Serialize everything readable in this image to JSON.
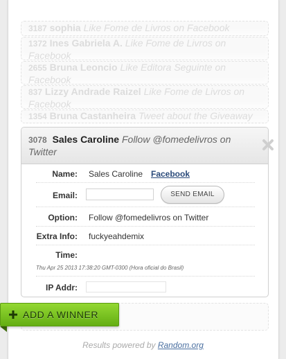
{
  "entries_faded": [
    {
      "number": "3187",
      "name": "sophia",
      "action": "Like Fome de Livros on Facebook"
    },
    {
      "number": "1372",
      "name": "Ines Gabriela A.",
      "action": "Like Fome de Livros on Facebook"
    },
    {
      "number": "2655",
      "name": "Bruna Leoncio",
      "action": "Like Editora Seguinte on Facebook"
    },
    {
      "number": "837",
      "name": "Lizzy Andrade Raizel",
      "action": "Like Fome de Livros on Facebook"
    },
    {
      "number": "1354",
      "name": "Bruna Castanheira",
      "action": "Tweet about the Giveaway"
    }
  ],
  "winner": {
    "number": "3078",
    "name": "Sales Caroline",
    "action": "Follow @fomedelivros on Twitter",
    "labels": {
      "name": "Name:",
      "email": "Email:",
      "option": "Option:",
      "extra": "Extra Info:",
      "time": "Time:",
      "ip": "IP Addr:"
    },
    "name_value": "Sales Caroline",
    "name_link": "Facebook",
    "email_value": "",
    "send_email_label": "SEND EMAIL",
    "option_value": "Follow @fomedelivros on Twitter",
    "extra_value": "fuckyeahdemix",
    "time_value": "Thu Apr 25 2013 17:38:20 GMT-0300 (Hora oficial do Brasil)",
    "ip_value": ""
  },
  "add_winner_label": "ADD A WINNER",
  "footer": {
    "prefix": "Results powered by ",
    "link": "Random.org"
  },
  "colors": {
    "accent_green": "#7cc422",
    "link_blue": "#2a4a7a"
  },
  "icons": {
    "close": "close-icon",
    "plus": "plus-icon"
  }
}
